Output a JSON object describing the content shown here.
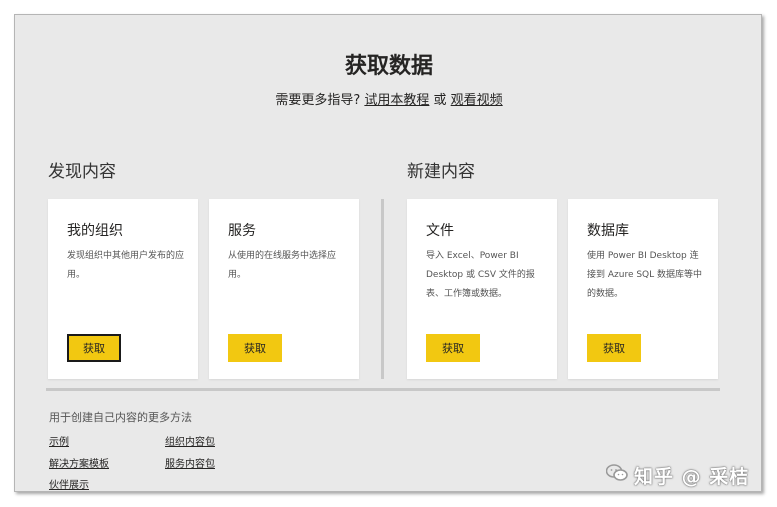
{
  "header": {
    "title": "获取数据",
    "subtitle_prefix": "需要更多指导? ",
    "tutorial_link": "试用本教程",
    "or_text": " 或 ",
    "video_link": "观看视频"
  },
  "sections": {
    "discover_title": "发现内容",
    "create_title": "新建内容"
  },
  "cards": [
    {
      "title": "我的组织",
      "desc": "发现组织中其他用户发布的应用。",
      "button": "获取"
    },
    {
      "title": "服务",
      "desc": "从使用的在线服务中选择应用。",
      "button": "获取"
    },
    {
      "title": "文件",
      "desc": "导入 Excel、Power BI Desktop 或 CSV 文件的报表、工作簿或数据。",
      "button": "获取"
    },
    {
      "title": "数据库",
      "desc": "使用 Power BI Desktop 连接到 Azure SQL 数据库等中的数据。",
      "button": "获取"
    }
  ],
  "more": {
    "title": "用于创建自己内容的更多方法",
    "links": [
      "示例",
      "组织内容包",
      "解决方案模板",
      "服务内容包",
      "伙伴展示"
    ]
  },
  "watermark": {
    "text": "知乎 @ 采桔",
    "icon": "wechat-icon"
  },
  "colors": {
    "accent": "#f2c811",
    "background": "#e9e9e9",
    "card": "#ffffff"
  }
}
